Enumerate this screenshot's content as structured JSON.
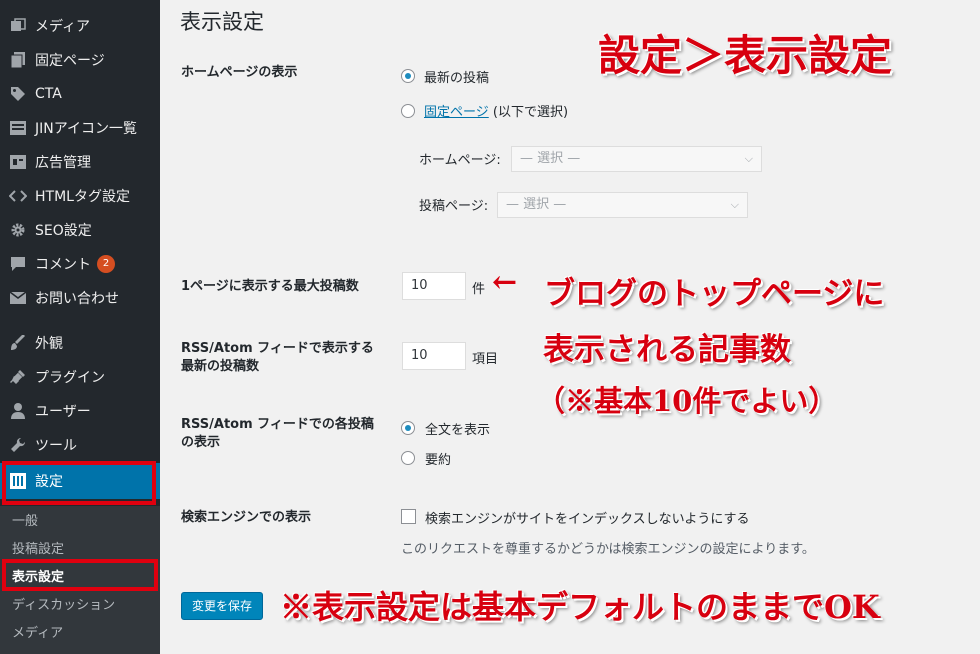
{
  "sidebar": {
    "items": [
      {
        "label": "メディア",
        "icon": "media-icon"
      },
      {
        "label": "固定ページ",
        "icon": "pages-icon"
      },
      {
        "label": "CTA",
        "icon": "tag-icon"
      },
      {
        "label": "JINアイコン一覧",
        "icon": "list-icon"
      },
      {
        "label": "広告管理",
        "icon": "ads-icon"
      },
      {
        "label": "HTMLタグ設定",
        "icon": "code-icon"
      },
      {
        "label": "SEO設定",
        "icon": "gear-icon"
      },
      {
        "label": "コメント",
        "icon": "comment-icon",
        "badge": "2"
      },
      {
        "label": "お問い合わせ",
        "icon": "mail-icon"
      },
      {
        "label": "外観",
        "icon": "brush-icon"
      },
      {
        "label": "プラグイン",
        "icon": "plugin-icon"
      },
      {
        "label": "ユーザー",
        "icon": "user-icon"
      },
      {
        "label": "ツール",
        "icon": "wrench-icon"
      },
      {
        "label": "設定",
        "icon": "settings-icon",
        "current": true
      }
    ],
    "submenu": [
      {
        "label": "一般"
      },
      {
        "label": "投稿設定"
      },
      {
        "label": "表示設定",
        "current": true
      },
      {
        "label": "ディスカッション"
      },
      {
        "label": "メディア"
      }
    ]
  },
  "main": {
    "title": "表示設定",
    "homepage": {
      "label": "ホームページの表示",
      "option_latest": "最新の投稿",
      "option_static_link": "固定ページ",
      "option_static_suffix": " (以下で選択)",
      "selected": "latest",
      "homepage_select_label": "ホームページ:",
      "homepage_select_value": "— 選択 —",
      "posts_select_label": "投稿ページ:",
      "posts_select_value": "— 選択 —"
    },
    "posts_per_page": {
      "label": "1ページに表示する最大投稿数",
      "value": "10",
      "unit": "件"
    },
    "rss_count": {
      "label_line1": "RSS/Atom フィードで表示する",
      "label_line2": "最新の投稿数",
      "value": "10",
      "unit": "項目"
    },
    "rss_content": {
      "label_line1": "RSS/Atom フィードでの各投稿",
      "label_line2": "の表示",
      "option_full": "全文を表示",
      "option_summary": "要約",
      "selected": "full"
    },
    "search_engine": {
      "label": "検索エンジンでの表示",
      "checkbox_label": "検索エンジンがサイトをインデックスしないようにする",
      "checked": false,
      "description": "このリクエストを尊重するかどうかは検索エンジンの設定によります。"
    },
    "save_button": "変更を保存"
  },
  "annotations": {
    "title": "設定＞表示設定",
    "arrow": "←",
    "note_line1": "ブログのトップページに",
    "note_line2": "表示される記事数",
    "note_line3": "（※基本10件でよい）",
    "footer_note": "※表示設定は基本デフォルトのままでOK"
  },
  "colors": {
    "sidebar_bg": "#23282d",
    "accent": "#0073aa",
    "highlight_red": "#e0000f"
  }
}
